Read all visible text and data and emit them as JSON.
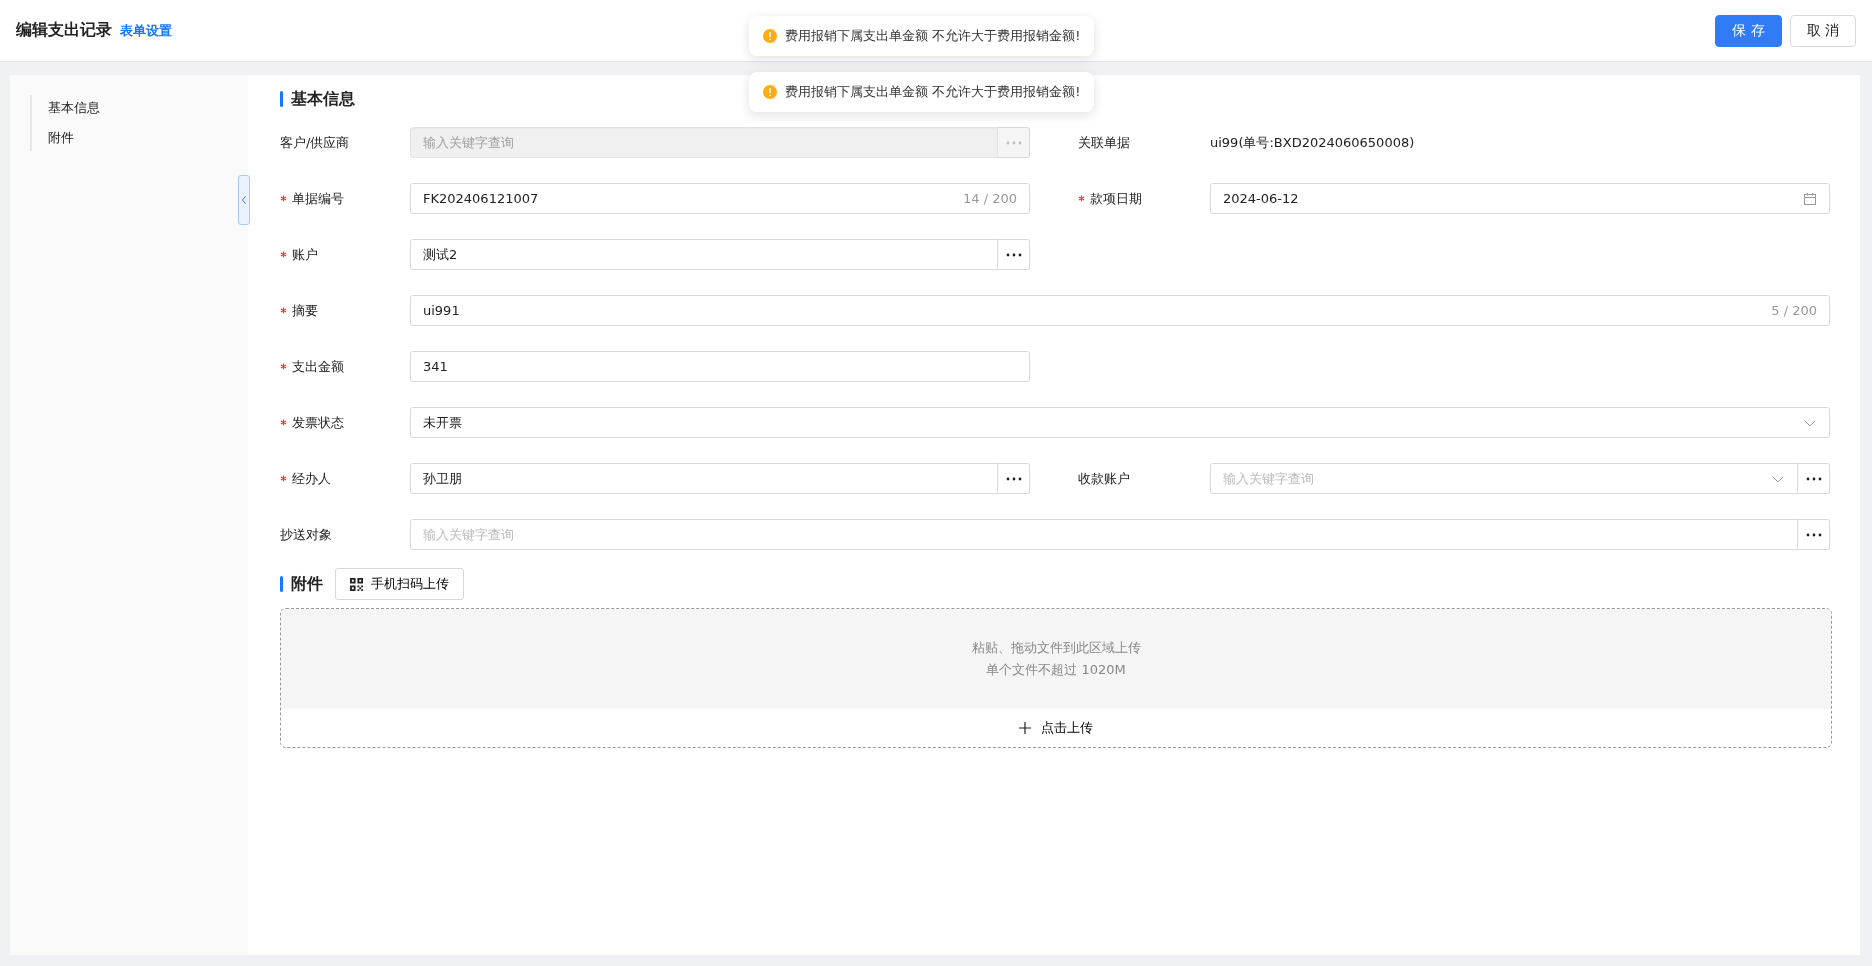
{
  "header": {
    "title": "编辑支出记录",
    "settings_link": "表单设置",
    "buttons": [
      {
        "label": "保 存",
        "kind": "primary"
      },
      {
        "label": "取 消",
        "kind": "default"
      }
    ]
  },
  "toasts": [
    {
      "message": "费用报销下属支出单金额 不允许大于费用报销金额!"
    },
    {
      "message": "费用报销下属支出单金额 不允许大于费用报销金额!"
    }
  ],
  "nav": {
    "items": [
      {
        "label": "基本信息"
      },
      {
        "label": "附件"
      }
    ]
  },
  "basic_info": {
    "title": "基本信息",
    "fields": [
      {
        "label": "客户/供应商",
        "required": false,
        "kind": "picker",
        "wide": false,
        "disabled": true,
        "placeholder": "输入关键字查询"
      },
      {
        "label": "关联单据",
        "required": false,
        "kind": "static",
        "wide": false,
        "disabled": false,
        "value": "ui99(单号:BXD2024060650008)"
      },
      {
        "label": "单据编号",
        "required": true,
        "kind": "counter",
        "wide": false,
        "disabled": false,
        "value": "FK202406121007",
        "counter": "14 / 200"
      },
      {
        "label": "款项日期",
        "required": true,
        "kind": "date",
        "wide": false,
        "disabled": false,
        "value": "2024-06-12"
      },
      {
        "label": "账户",
        "required": true,
        "kind": "picker",
        "wide": false,
        "disabled": false,
        "value": "测试2"
      },
      {
        "label": "摘要",
        "required": true,
        "kind": "counter",
        "wide": true,
        "disabled": false,
        "value": "ui991",
        "counter": "5 / 200"
      },
      {
        "label": "支出金额",
        "required": true,
        "kind": "text",
        "wide": false,
        "disabled": false,
        "value": "341"
      },
      {
        "label": "发票状态",
        "required": true,
        "kind": "select",
        "wide": true,
        "disabled": false,
        "value": "未开票"
      },
      {
        "label": "经办人",
        "required": true,
        "kind": "picker",
        "wide": false,
        "disabled": false,
        "value": "孙卫朋"
      },
      {
        "label": "收款账户",
        "required": false,
        "kind": "select-picker",
        "wide": false,
        "disabled": false,
        "placeholder": "输入关键字查询"
      },
      {
        "label": "抄送对象",
        "required": false,
        "kind": "picker",
        "wide": true,
        "disabled": false,
        "placeholder": "输入关键字查询"
      }
    ]
  },
  "attachments": {
    "title": "附件",
    "scan_button": "手机扫码上传",
    "drop_hint": [
      "粘贴、拖动文件到此区域上传",
      "单个文件不超过 1020M"
    ],
    "upload_button": "点击上传"
  }
}
